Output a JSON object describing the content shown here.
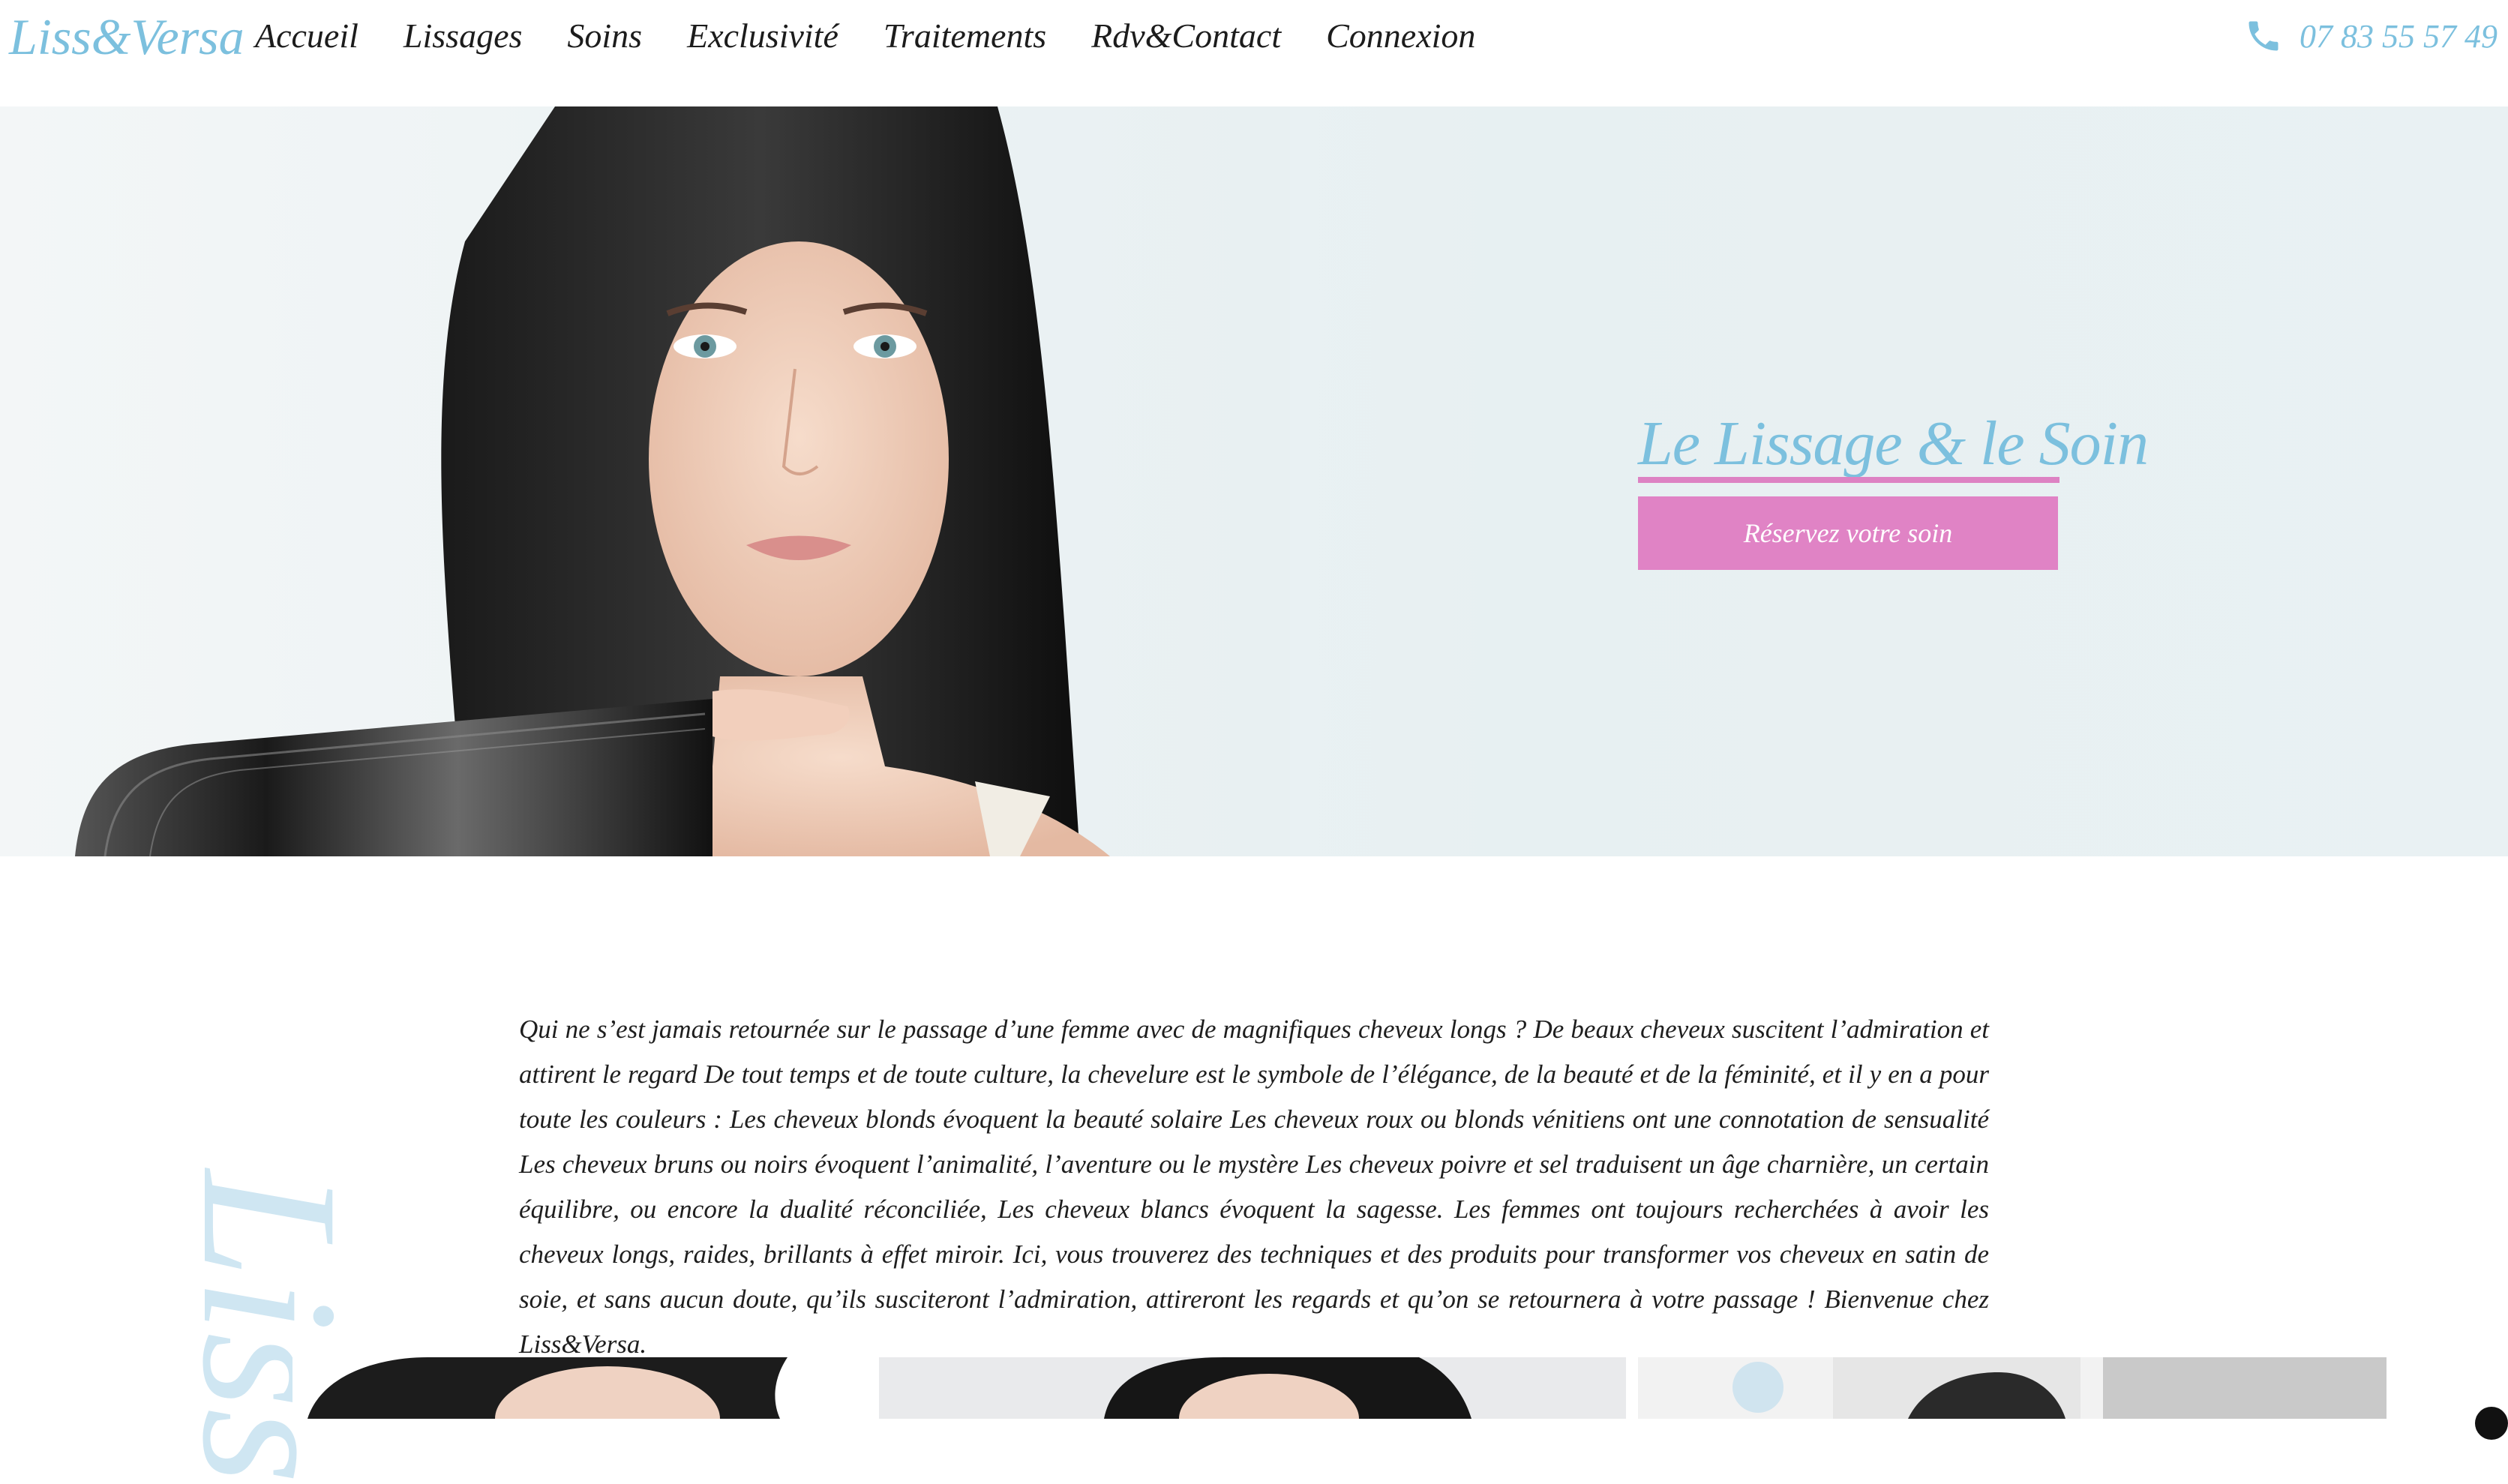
{
  "header": {
    "logo": "Liss&Versa",
    "nav": [
      "Accueil",
      "Lissages",
      "Soins",
      "Exclusivité",
      "Traitements",
      "Rdv&Contact",
      "Connexion"
    ],
    "phone_icon": "phone-icon",
    "phone": "07 83 55 57 49"
  },
  "hero": {
    "title": "Le Lissage & le Soin",
    "cta": "Réservez votre soin"
  },
  "intro": {
    "watermark": "Liss",
    "text": "Qui ne s’est jamais retournée sur le passage d’une femme avec de magnifiques cheveux longs ? De beaux cheveux suscitent l’admiration et attirent le regard De tout temps et de toute culture, la chevelure est le symbole de l’élégance, de la beauté et de la féminité, et il y en a pour toute les couleurs : Les cheveux blonds évoquent la beauté solaire Les cheveux roux ou blonds vénitiens ont une connotation de sensualité Les cheveux bruns ou noirs évoquent l’animalité, l’aventure ou le mystère Les cheveux poivre et sel traduisent un âge charnière, un certain équilibre, ou encore la dualité réconciliée, Les cheveux blancs évoquent la sagesse. Les femmes ont toujours recherchées à avoir les cheveux longs, raides, brillants à effet miroir. Ici, vous trouverez des techniques et des produits pour transformer vos cheveux en satin de soie, et sans aucun doute, qu’ils susciteront l’admiration, attireront les regards et qu’on se retournera à votre passage ! Bienvenue chez Liss&Versa."
  },
  "colors": {
    "accent_blue": "#7cc0de",
    "accent_pink": "#e083c5",
    "text": "#1e1e1e"
  }
}
